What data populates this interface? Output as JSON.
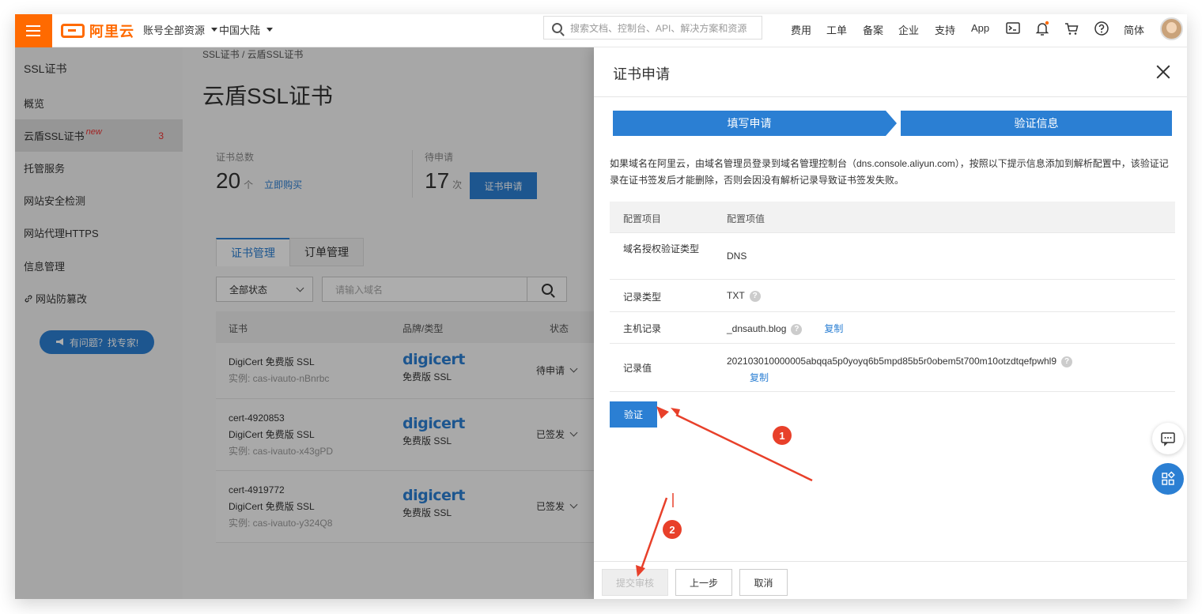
{
  "topbar": {
    "logo_text": "阿里云",
    "account_resources": "账号全部资源",
    "region": "中国大陆",
    "search_placeholder": "搜索文档、控制台、API、解决方案和资源",
    "nav": [
      "费用",
      "工单",
      "备案",
      "企业",
      "支持",
      "App"
    ],
    "lang": "简体"
  },
  "sidebar": {
    "title": "SSL证书",
    "items": [
      {
        "label": "概览"
      },
      {
        "label": "云盾SSL证书",
        "badge": "new",
        "count": "3"
      },
      {
        "label": "托管服务"
      },
      {
        "label": "网站安全检测"
      },
      {
        "label": "网站代理HTTPS"
      },
      {
        "label": "信息管理"
      },
      {
        "label": "网站防篡改"
      }
    ],
    "help_label": "有问题？找专家!"
  },
  "main": {
    "breadcrumb": "SSL证书  /  云盾SSL证书",
    "title": "云盾SSL证书",
    "stats": {
      "total_label": "证书总数",
      "total_value": "20",
      "total_unit": "个",
      "buy_link": "立即购买",
      "pending_label": "待申请",
      "pending_value": "17",
      "pending_unit": "次",
      "apply_button": "证书申请"
    },
    "tabs": [
      "证书管理",
      "订单管理"
    ],
    "filter_status": "全部状态",
    "domain_placeholder": "请输入域名",
    "table": {
      "headers": [
        "证书",
        "品牌/类型",
        "状态"
      ],
      "rows": [
        {
          "name": "",
          "product": "DigiCert 免费版 SSL",
          "instance": "实例: cas-ivauto-nBnrbc",
          "brand": "digicert",
          "type": "免费版 SSL",
          "status": "待申请"
        },
        {
          "name": "cert-4920853",
          "product": "DigiCert 免费版 SSL",
          "instance": "实例: cas-ivauto-x43gPD",
          "brand": "digicert",
          "type": "免费版 SSL",
          "status": "已签发"
        },
        {
          "name": "cert-4919772",
          "product": "DigiCert 免费版 SSL",
          "instance": "实例: cas-ivauto-y324Q8",
          "brand": "digicert",
          "type": "免费版 SSL",
          "status": "已签发"
        }
      ]
    }
  },
  "drawer": {
    "title": "证书申请",
    "steps": [
      "填写申请",
      "验证信息"
    ],
    "description": "如果域名在阿里云，由域名管理员登录到域名管理控制台（dns.console.aliyun.com），按照以下提示信息添加到解析配置中，该验证记录在证书签发后才能删除，否则会因没有解析记录导致证书签发失败。",
    "table": {
      "headers": [
        "配置项目",
        "配置项值"
      ],
      "rows": [
        {
          "key": "域名授权验证类型",
          "value": "DNS"
        },
        {
          "key": "记录类型",
          "value": "TXT"
        },
        {
          "key": "主机记录",
          "value": "_dnsauth.blog",
          "copy": "复制"
        },
        {
          "key": "记录值",
          "value": "202103010000005abqqa5p0yoyq6b5mpd85b5r0obem5t700m10otzdtqefpwhl9",
          "copy": "复制"
        }
      ]
    },
    "verify_button": "验证",
    "footer": {
      "submit": "提交审核",
      "prev": "上一步",
      "cancel": "取消"
    }
  },
  "annotations": [
    "1",
    "2"
  ],
  "colors": {
    "brand": "#ff6a00",
    "primary": "#2b7fd3",
    "annotation": "#e8402a"
  }
}
